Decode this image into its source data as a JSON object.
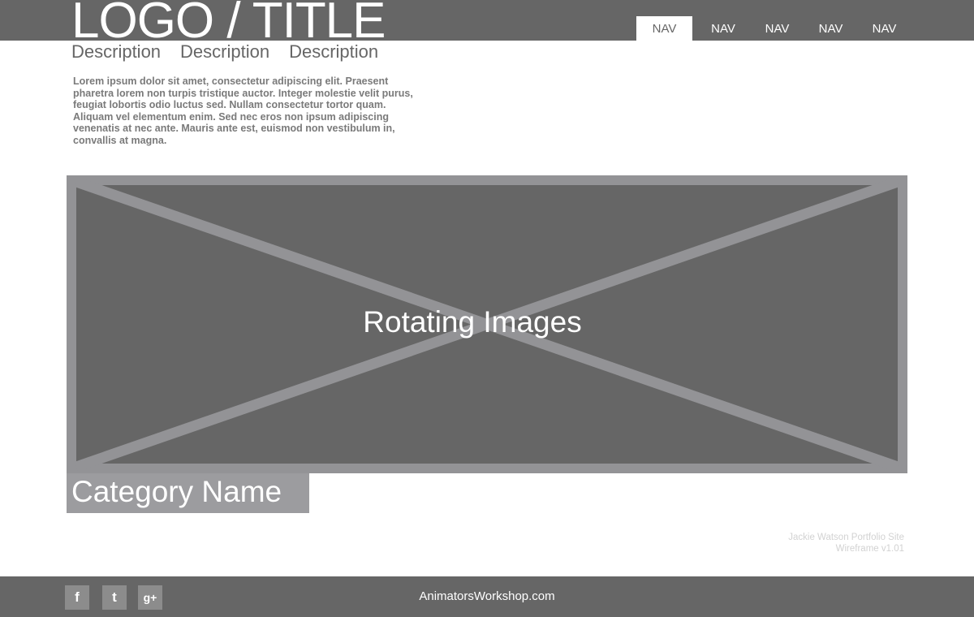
{
  "header": {
    "logo_title": "LOGO / TITLE",
    "nav": [
      "NAV",
      "NAV",
      "NAV",
      "NAV",
      "NAV"
    ],
    "active_nav_index": 0,
    "descriptions": [
      "Description",
      "Description",
      "Description"
    ]
  },
  "intro": {
    "text": "Lorem ipsum dolor sit amet, consectetur adipiscing elit. Praesent pharetra lorem non turpis tristique auctor. Integer molestie velit purus, feugiat lobortis odio luctus sed. Nullam consectetur tortor quam. Aliquam vel elementum enim. Sed nec eros non ipsum adipiscing venenatis at nec ante. Mauris ante est, euismod non vestibulum in, convallis at magna."
  },
  "hero": {
    "label": "Rotating Images"
  },
  "category": {
    "name": "Category Name"
  },
  "credits": {
    "line1": "Jackie Watson Portfolio Site",
    "line2": "Wireframe v1.01"
  },
  "footer": {
    "social": [
      {
        "icon": "facebook-icon",
        "glyph": "f"
      },
      {
        "icon": "twitter-icon",
        "glyph": "t"
      },
      {
        "icon": "google-plus-icon",
        "glyph": "g+"
      }
    ],
    "site": "AnimatorsWorkshop.com"
  },
  "colors": {
    "bar": "#666666",
    "placeholder": "#939396",
    "category_bg": "#9c9c9f",
    "text_dark": "#666666"
  }
}
